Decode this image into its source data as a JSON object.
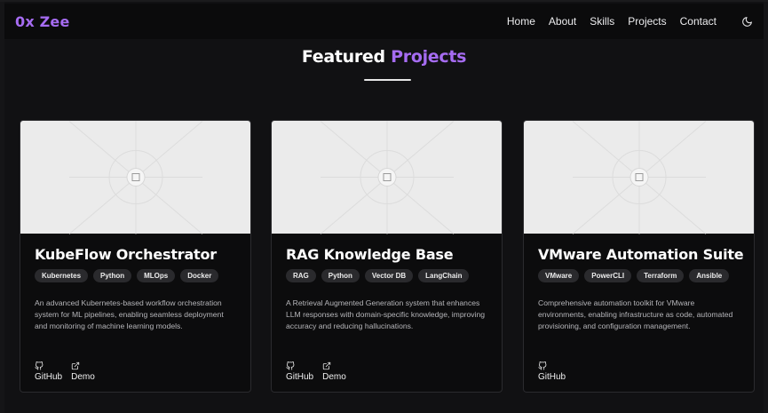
{
  "brand": {
    "logo": "0x Zee"
  },
  "nav": {
    "items": [
      "Home",
      "About",
      "Skills",
      "Projects",
      "Contact"
    ],
    "theme_icon": "moon-icon"
  },
  "section": {
    "title_main": "Featured",
    "title_accent": "Projects"
  },
  "colors": {
    "accent": "#a66cf2",
    "background": "#111113",
    "card": "#0c0c0d",
    "tag_bg": "#2a2a2d"
  },
  "projects": [
    {
      "title": "KubeFlow Orchestrator",
      "tags": [
        "Kubernetes",
        "Python",
        "MLOps",
        "Docker"
      ],
      "description": "An advanced Kubernetes-based workflow orchestration system for ML pipelines, enabling seamless deployment and monitoring of machine learning models.",
      "links": [
        {
          "label": "GitHub",
          "icon": "github-icon"
        },
        {
          "label": "Demo",
          "icon": "external-link-icon"
        }
      ]
    },
    {
      "title": "RAG Knowledge Base",
      "tags": [
        "RAG",
        "Python",
        "Vector DB",
        "LangChain"
      ],
      "description": "A Retrieval Augmented Generation system that enhances LLM responses with domain-specific knowledge, improving accuracy and reducing hallucinations.",
      "links": [
        {
          "label": "GitHub",
          "icon": "github-icon"
        },
        {
          "label": "Demo",
          "icon": "external-link-icon"
        }
      ]
    },
    {
      "title": "VMware Automation Suite",
      "tags": [
        "VMware",
        "PowerCLI",
        "Terraform",
        "Ansible"
      ],
      "description": "Comprehensive automation toolkit for VMware environments, enabling infrastructure as code, automated provisioning, and configuration management.",
      "links": [
        {
          "label": "GitHub",
          "icon": "github-icon"
        }
      ]
    }
  ]
}
